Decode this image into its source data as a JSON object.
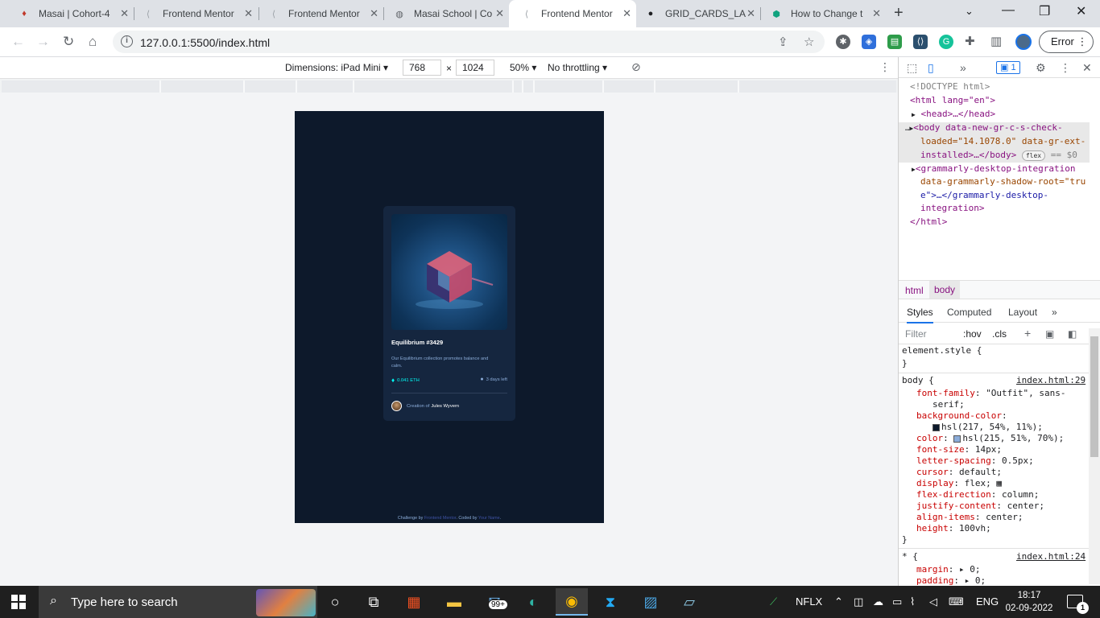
{
  "browser": {
    "tabs": [
      {
        "title": "Masai | Cohort-4",
        "icon": "masai-icon"
      },
      {
        "title": "Frontend Mentor",
        "icon": "frontend-mentor-icon"
      },
      {
        "title": "Frontend Mentor",
        "icon": "frontend-mentor-icon"
      },
      {
        "title": "Masai School | Co",
        "icon": "globe-icon"
      },
      {
        "title": "Frontend Mentor",
        "icon": "frontend-mentor-icon",
        "active": true
      },
      {
        "title": "GRID_CARDS_LA",
        "icon": "github-icon"
      },
      {
        "title": "How to Change t",
        "icon": "chatgpt-icon"
      }
    ],
    "url": "127.0.0.1:5500/index.html",
    "error_label": "Error"
  },
  "device_toolbar": {
    "dimensions_label": "Dimensions: iPad Mini",
    "width": "768",
    "height": "1024",
    "times": "×",
    "zoom": "50%",
    "throttling": "No throttling"
  },
  "page": {
    "card": {
      "title": "Equilibrium #3429",
      "description": "Our Equilibrium collection promotes balance and calm.",
      "price": "0.041 ETH",
      "days_left": "3 days left",
      "creator_prefix": "Creation of",
      "creator_name": "Jules Wyvern"
    },
    "attribution": {
      "prefix": "Challenge by",
      "link1": "Frontend Mentor",
      "middle": ". Coded by",
      "link2": "Your Name",
      "suffix": "."
    },
    "colors": {
      "background": "#0d192b",
      "card": "#15263f",
      "accent": "#00fff8",
      "muted": "#8bacd9"
    }
  },
  "devtools": {
    "issues_count": "1",
    "dom": {
      "doctype": "<!DOCTYPE html>",
      "html_open": "<html lang=\"en\">",
      "head": "<head>…</head>",
      "body_line1": "<body data-new-gr-c-s-check-",
      "body_line2": "loaded=\"14.1078.0\" data-gr-ext-",
      "body_line3": "installed>…</body>",
      "flex_badge": "flex",
      "eq0": "== $0",
      "gram_line1": "<grammarly-desktop-integration",
      "gram_line2": "data-grammarly-shadow-root=\"tru",
      "gram_line3": "e\">…</grammarly-desktop-",
      "gram_line4": "integration>",
      "html_close": "</html>"
    },
    "breadcrumbs": [
      "html",
      "body"
    ],
    "panel_tabs": [
      "Styles",
      "Computed",
      "Layout"
    ],
    "filter_placeholder": "Filter",
    "hov": ":hov",
    "cls": ".cls",
    "styles": {
      "element_style": "element.style {",
      "close": "}",
      "body_selector": "body {",
      "body_source": "index.html:29",
      "star_selector": "* {",
      "star_source": "index.html:24",
      "rules": [
        {
          "prop": "font-family",
          "val": "\"Outfit\", sans-"
        },
        {
          "prop": "",
          "val": "serif;"
        },
        {
          "prop": "background-color",
          "val": ""
        },
        {
          "prop": "",
          "val": "hsl(217, 54%, 11%);"
        },
        {
          "prop": "color",
          "val": "hsl(215, 51%, 70%);"
        },
        {
          "prop": "font-size",
          "val": "14px;"
        },
        {
          "prop": "letter-spacing",
          "val": "0.5px;"
        },
        {
          "prop": "cursor",
          "val": "default;"
        },
        {
          "prop": "display",
          "val": "flex;"
        },
        {
          "prop": "flex-direction",
          "val": "column;"
        },
        {
          "prop": "justify-content",
          "val": "center;"
        },
        {
          "prop": "align-items",
          "val": "center;"
        },
        {
          "prop": "height",
          "val": "100vh;"
        }
      ],
      "star_rules": [
        {
          "prop": "margin",
          "val": "▸ 0;"
        },
        {
          "prop": "padding",
          "val": "▸ 0;"
        }
      ]
    }
  },
  "taskbar": {
    "search_placeholder": "Type here to search",
    "mail_badge": "99+",
    "stock": "NFLX",
    "language": "ENG",
    "time": "18:17",
    "date": "02-09-2022",
    "notification_count": "1"
  }
}
